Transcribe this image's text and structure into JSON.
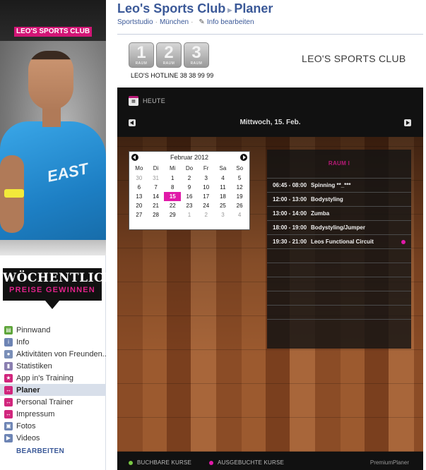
{
  "page": {
    "title_main": "Leo's Sports Club",
    "title_sub": "Planer",
    "category": "Sportstudio",
    "city": "München",
    "edit_info": "Info bearbeiten"
  },
  "left": {
    "brand_label": "LEO'S SPORTS CLUB",
    "shirt_text": "EAST",
    "promo_line1": "WÖCHENTLICH",
    "promo_line2": "PREISE GEWINNEN",
    "nav": [
      {
        "label": "Pinnwand",
        "icon": "wall-icon",
        "color": "#5ea53a"
      },
      {
        "label": "Info",
        "icon": "info-icon",
        "color": "#6d84b4"
      },
      {
        "label": "Aktivitäten von Freunden...",
        "icon": "friends-icon",
        "color": "#7a8fb8"
      },
      {
        "label": "Statistiken",
        "icon": "stats-icon",
        "color": "#8a7fb0"
      },
      {
        "label": "App in's Training",
        "icon": "app-icon",
        "color": "#d1267d"
      },
      {
        "label": "Planer",
        "icon": "planner-icon",
        "color": "#d1267d"
      },
      {
        "label": "Personal Trainer",
        "icon": "trainer-icon",
        "color": "#d1267d"
      },
      {
        "label": "Impressum",
        "icon": "imprint-icon",
        "color": "#d1267d"
      },
      {
        "label": "Fotos",
        "icon": "photos-icon",
        "color": "#6d84b4"
      },
      {
        "label": "Videos",
        "icon": "videos-icon",
        "color": "#6d84b4"
      }
    ],
    "nav_edit": "BEARBEITEN"
  },
  "app": {
    "rooms": [
      {
        "num": "1",
        "label": "RAUM"
      },
      {
        "num": "2",
        "label": "RAUM"
      },
      {
        "num": "3",
        "label": "RAUM"
      }
    ],
    "hotline": "LEO'S HOTLINE 38 38 99 99",
    "logo": "LEO'S SPORTS CLUB",
    "today": "HEUTE",
    "day_title": "Mittwoch, 15. Feb.",
    "calendar": {
      "month": "Februar 2012",
      "weekdays": [
        "Mo",
        "Di",
        "Mi",
        "Do",
        "Fr",
        "Sa",
        "So"
      ],
      "weeks": [
        [
          "30",
          "31",
          "1",
          "2",
          "3",
          "4",
          "5"
        ],
        [
          "6",
          "7",
          "8",
          "9",
          "10",
          "11",
          "12"
        ],
        [
          "13",
          "14",
          "15",
          "16",
          "17",
          "18",
          "19"
        ],
        [
          "20",
          "21",
          "22",
          "23",
          "24",
          "25",
          "26"
        ],
        [
          "27",
          "28",
          "29",
          "1",
          "2",
          "3",
          "4"
        ]
      ],
      "selected": "15"
    },
    "room_title": "RAUM I",
    "slots": [
      {
        "time": "06:45 - 08:00",
        "course": "Spinning **_***",
        "booked": false
      },
      {
        "time": "12:00 - 13:00",
        "course": "Bodystyling",
        "booked": false
      },
      {
        "time": "13:00 - 14:00",
        "course": "Zumba",
        "booked": false
      },
      {
        "time": "18:00 - 19:00",
        "course": "Bodystyling/Jumper",
        "booked": false
      },
      {
        "time": "19:30 - 21:00",
        "course": "Leos Functional Circuit",
        "booked": true
      }
    ],
    "legend": {
      "bookable": "BUCHBARE KURSE",
      "booked": "AUSGEBUCHTE KURSE",
      "bookable_color": "#7ac943",
      "booked_color": "#e019a8",
      "premium": "PremiumPlaner"
    }
  }
}
